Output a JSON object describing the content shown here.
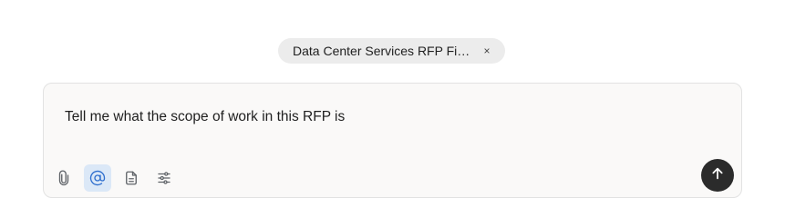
{
  "attachment": {
    "label": "Data Center Services RFP Fi…",
    "close_glyph": "×"
  },
  "composer": {
    "prompt_text": "Tell me what the scope of work in this RFP is"
  },
  "toolbar": {
    "icons": [
      "paperclip-icon",
      "at-mention-icon",
      "document-icon",
      "sliders-icon"
    ],
    "active_tool": "at-mention-icon",
    "active_color": "#2f6fce"
  },
  "send": {
    "icon": "arrow-up-icon",
    "color": "#2b2b2b"
  }
}
